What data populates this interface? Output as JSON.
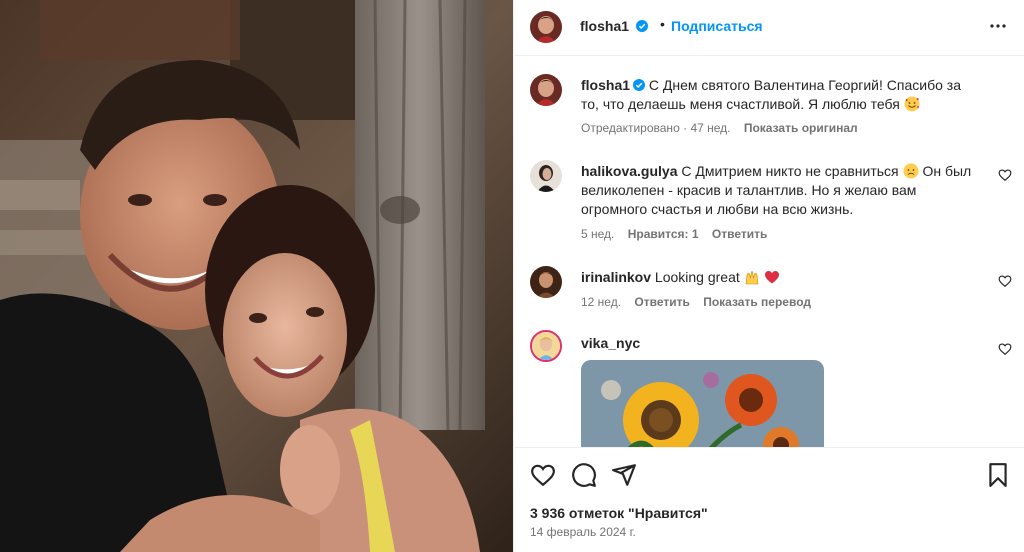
{
  "post": {
    "username": "flosha1",
    "follow_label": "Подписаться",
    "dot": "•",
    "caption_text": "С Днем святого Валентина Георгий! Спасибо за то, что делаешь меня счастливой. Я люблю тебя",
    "caption_emoji": "smiling-face-with-hearts",
    "edited_label": "Отредактировано",
    "time_ago": "47 нед.",
    "show_original": "Показать оригинал",
    "likes": "3 936 отметок \"Нравится\"",
    "date": "14 февраль 2024 г."
  },
  "comments": [
    {
      "username": "halikova.gulya",
      "text": "С Дмитрием никто не сравниться",
      "emoji": "sad-face",
      "text_after": "Он был великолепен - красив и талантлив. Но я желаю вам огромного счастья и любви на всю жизнь.",
      "time": "5 нед.",
      "likes_label": "Нравится: 1",
      "reply_label": "Ответить"
    },
    {
      "username": "irinalinkov",
      "text": "Looking great",
      "emojis": [
        "praising-hands",
        "red-heart"
      ],
      "time": "12 нед.",
      "reply_label": "Ответить",
      "translate_label": "Показать перевод"
    },
    {
      "username": "vika_nyc",
      "text": "",
      "sticker": "sunflower-art-image"
    }
  ],
  "colors": {
    "link_blue": "#0095f6",
    "text": "#262626",
    "meta_grey": "#737373",
    "heart_red": "#e0245e"
  },
  "icons": [
    "verified-badge-icon",
    "more-options-icon",
    "heart-outline-icon",
    "comment-icon",
    "share-icon",
    "bookmark-icon"
  ]
}
